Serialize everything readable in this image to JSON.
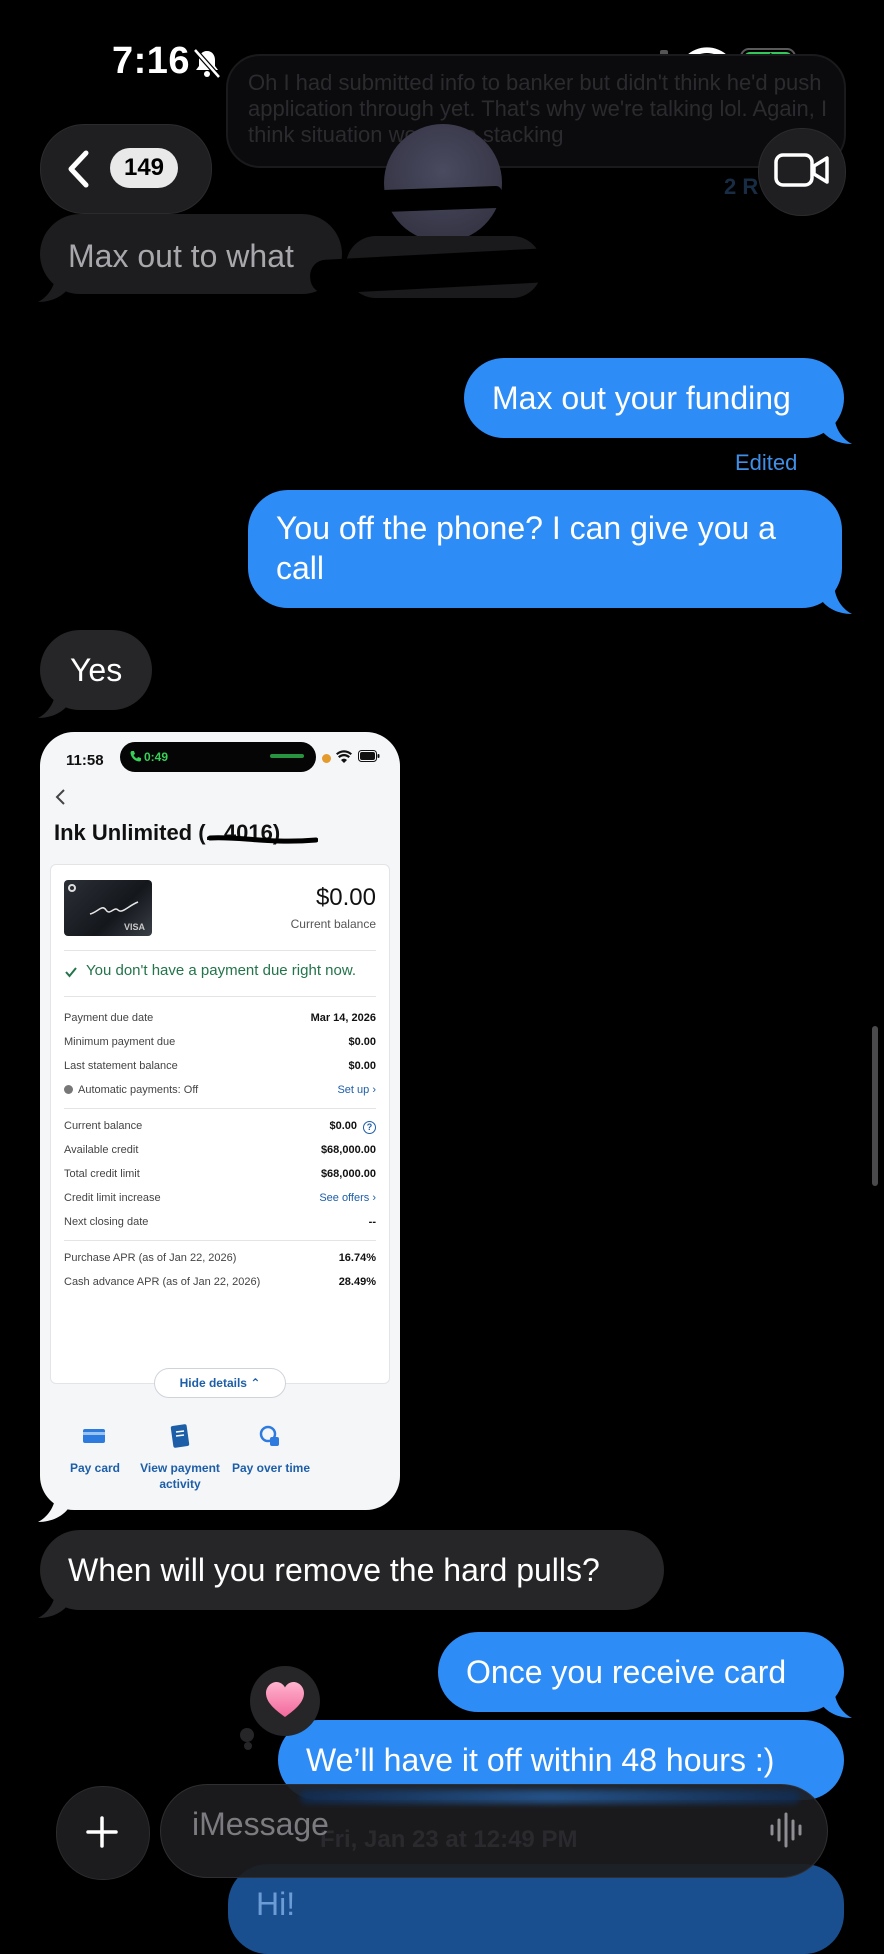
{
  "status_bar": {
    "time": "7:16"
  },
  "header": {
    "back_badge": "149"
  },
  "ghost_message": {
    "text": "Oh I had submitted info to banker but didn't think he'd push application through yet. That's why we're talking lol. Again, I think situation would be stacking",
    "read": "2 R"
  },
  "messages": {
    "m1": "Max out to what",
    "m2": "Max out your funding",
    "edited": "Edited",
    "m3": "You off the phone? I can give you a call",
    "m4": "Yes",
    "m5": "When will you remove the hard pulls?",
    "m6": "Once you receive card",
    "m7": "We’ll have it off within 48 hours :)",
    "m8": "Hi!",
    "reaction": "heart"
  },
  "screenshot": {
    "time": "11:58",
    "call_timer": "0:49",
    "title": "Ink Unlimited (...4016)",
    "balance": "$0.00",
    "balance_label": "Current balance",
    "card_brand": "VISA",
    "no_payment": "You don't have a payment due right now.",
    "rows1": [
      {
        "label": "Payment due date",
        "value": "Mar 14, 2026"
      },
      {
        "label": "Minimum payment due",
        "value": "$0.00"
      },
      {
        "label": "Last statement balance",
        "value": "$0.00"
      },
      {
        "label": "Automatic payments: Off",
        "value": "Set up"
      }
    ],
    "rows2": [
      {
        "label": "Current balance",
        "value": "$0.00"
      },
      {
        "label": "Available credit",
        "value": "$68,000.00"
      },
      {
        "label": "Total credit limit",
        "value": "$68,000.00"
      },
      {
        "label": "Credit limit increase",
        "value": "See offers"
      },
      {
        "label": "Next closing date",
        "value": "--"
      }
    ],
    "rows3": [
      {
        "label": "Purchase APR (as of Jan 22, 2026)",
        "value": "16.74%"
      },
      {
        "label": "Cash advance APR (as of Jan 22, 2026)",
        "value": "28.49%"
      }
    ],
    "hide_details": "Hide details",
    "actions": [
      "Pay card",
      "View payment activity",
      "Pay over time"
    ]
  },
  "input_bar": {
    "placeholder": "iMessage",
    "timestamp_ghost": "Fri, Jan 23 at 12:49 PM"
  },
  "colors": {
    "outgoing": "#2e8cf6",
    "incoming": "#262628",
    "link": "#1d5ea8",
    "success": "#23744a"
  }
}
